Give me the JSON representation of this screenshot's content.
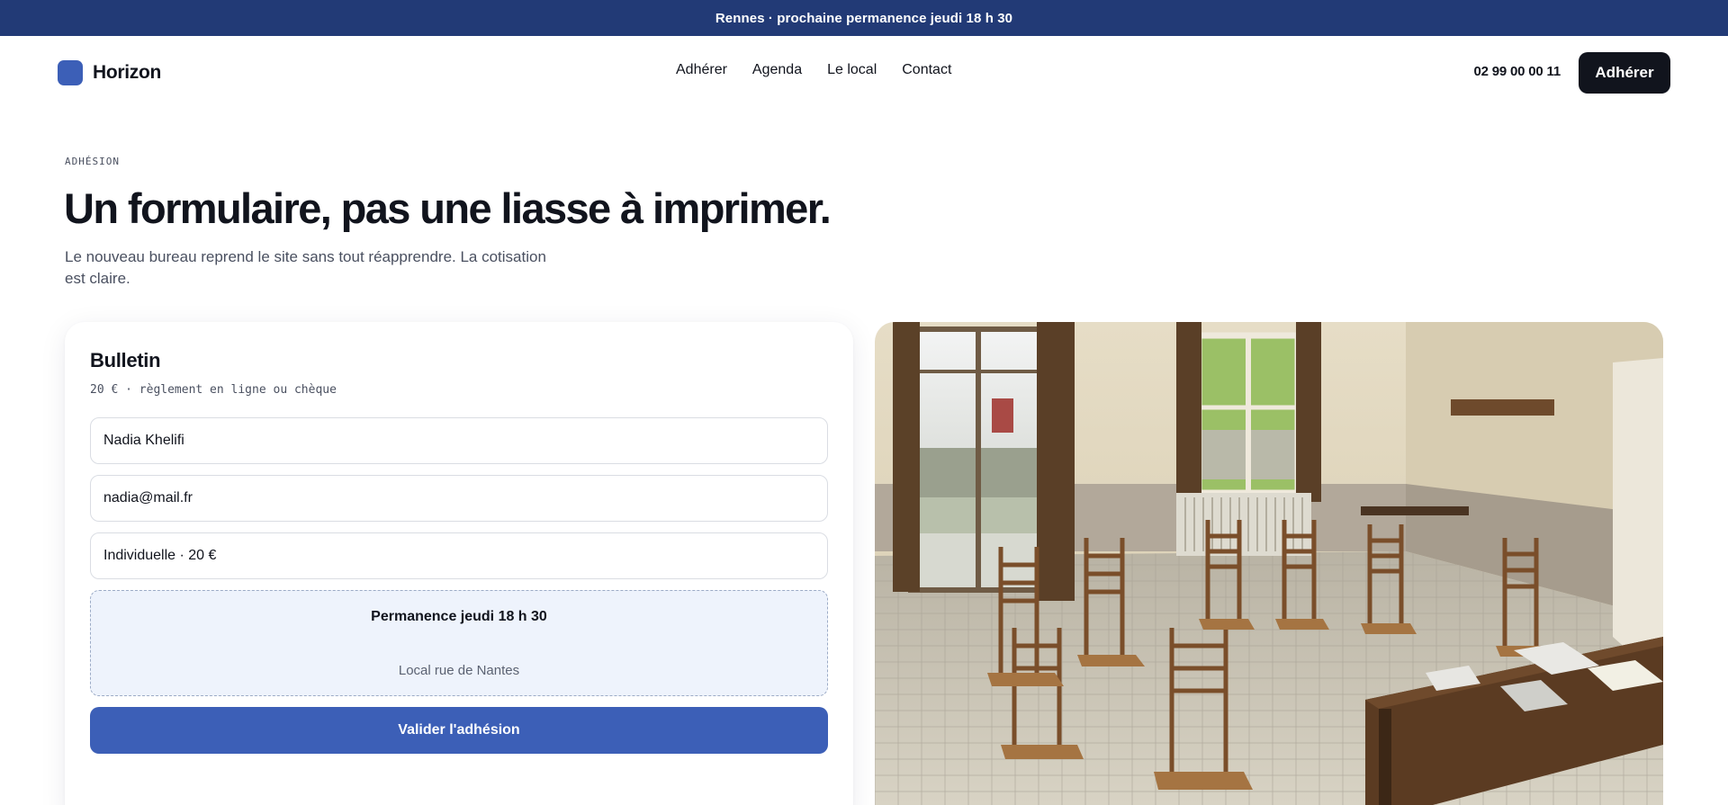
{
  "announcement": "Rennes · prochaine permanence jeudi 18 h 30",
  "header": {
    "brand_name": "Horizon",
    "nav": [
      {
        "label": "Adhérer"
      },
      {
        "label": "Agenda"
      },
      {
        "label": "Le local"
      },
      {
        "label": "Contact"
      }
    ],
    "phone": "02 99 00 00 11",
    "cta_label": "Adhérer"
  },
  "hero": {
    "eyebrow": "ADHÉSION",
    "title": "Un formulaire, pas une liasse à imprimer.",
    "lead": "Le nouveau bureau reprend le site sans tout réapprendre. La cotisation est claire."
  },
  "form": {
    "title": "Bulletin",
    "subtitle": "20 € · règlement en ligne ou chèque",
    "name_value": "Nadia Khelifi",
    "email_value": "nadia@mail.fr",
    "membership_value": "Individuelle · 20 €",
    "slot_title": "Permanence jeudi 18 h 30",
    "slot_place": "Local rue de Nantes",
    "submit_label": "Valider l'adhésion"
  },
  "colors": {
    "announcement_bg": "#223a76",
    "accent": "#3c5fb7",
    "dark": "#11141d",
    "slot_bg": "#eef3fc"
  },
  "icons": {
    "brand": "rounded-square-logo"
  }
}
